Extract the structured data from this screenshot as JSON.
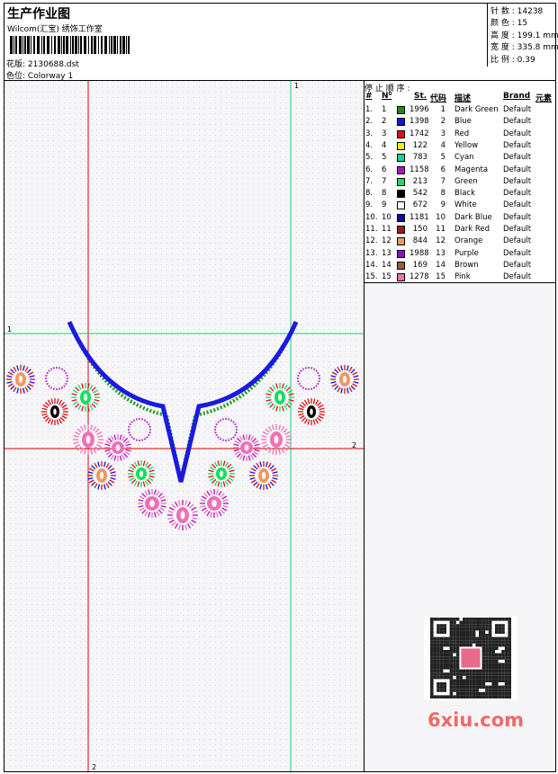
{
  "header": {
    "title": "生产作业图",
    "company": "Wilcom(汇宝) 绣饰工作室",
    "design_label": "花版:",
    "design_value": "2130688.dst",
    "colorway_label": "色位:",
    "colorway_value": "Colorway 1"
  },
  "stats": [
    {
      "label": "针 数 :",
      "value": "14238"
    },
    {
      "label": "颜 色 :",
      "value": "15"
    },
    {
      "label": "高 度 :",
      "value": "199.1 mm"
    },
    {
      "label": "宽 度 :",
      "value": "335.8 mm"
    },
    {
      "label": "比 例 :",
      "value": "0.39"
    }
  ],
  "guides": {
    "h1_label": "1",
    "h2_label": "2",
    "v1_label": "1",
    "v2_label": "2"
  },
  "legend": {
    "title": "停 止 顺 序 :",
    "headers": {
      "num": "#",
      "no": "N⁰",
      "st": "St.",
      "code": "代码",
      "desc": "描述",
      "brand": "Brand",
      "elem": "元素"
    },
    "rows": [
      {
        "num": "1.",
        "no": "1",
        "color": "#1a8a1a",
        "st": "1996",
        "code": "1",
        "desc": "Dark Green",
        "brand": "Default"
      },
      {
        "num": "2.",
        "no": "2",
        "color": "#1414d2",
        "st": "1398",
        "code": "2",
        "desc": "Blue",
        "brand": "Default"
      },
      {
        "num": "3.",
        "no": "3",
        "color": "#e01010",
        "st": "1742",
        "code": "3",
        "desc": "Red",
        "brand": "Default"
      },
      {
        "num": "4.",
        "no": "4",
        "color": "#f0f000",
        "st": "122",
        "code": "4",
        "desc": "Yellow",
        "brand": "Default"
      },
      {
        "num": "5.",
        "no": "5",
        "color": "#10d890",
        "st": "783",
        "code": "5",
        "desc": "Cyan",
        "brand": "Default"
      },
      {
        "num": "6.",
        "no": "6",
        "color": "#b010c8",
        "st": "1158",
        "code": "6",
        "desc": "Magenta",
        "brand": "Default"
      },
      {
        "num": "7.",
        "no": "7",
        "color": "#10e060",
        "st": "213",
        "code": "7",
        "desc": "Green",
        "brand": "Default"
      },
      {
        "num": "8.",
        "no": "8",
        "color": "#000000",
        "st": "542",
        "code": "8",
        "desc": "Black",
        "brand": "Default"
      },
      {
        "num": "9.",
        "no": "9",
        "color": "#ffffff",
        "st": "672",
        "code": "9",
        "desc": "White",
        "brand": "Default"
      },
      {
        "num": "10.",
        "no": "10",
        "color": "#0c0cb0",
        "st": "1181",
        "code": "10",
        "desc": "Dark Blue",
        "brand": "Default"
      },
      {
        "num": "11.",
        "no": "11",
        "color": "#a01818",
        "st": "150",
        "code": "11",
        "desc": "Dark Red",
        "brand": "Default"
      },
      {
        "num": "12.",
        "no": "12",
        "color": "#f09860",
        "st": "844",
        "code": "12",
        "desc": "Orange",
        "brand": "Default"
      },
      {
        "num": "13.",
        "no": "13",
        "color": "#8810c0",
        "st": "1988",
        "code": "13",
        "desc": "Purple",
        "brand": "Default"
      },
      {
        "num": "14.",
        "no": "14",
        "color": "#9a5a3a",
        "st": "169",
        "code": "14",
        "desc": "Brown",
        "brand": "Default"
      },
      {
        "num": "15.",
        "no": "15",
        "color": "#f070b8",
        "st": "1278",
        "code": "15",
        "desc": "Pink",
        "brand": "Default"
      }
    ]
  },
  "watermark": "6xiu.com",
  "colors": {
    "guide_red": "#e00000",
    "guide_green": "#20d070",
    "outline_blue": "#1a1ae0",
    "satin_green": "#20a020"
  }
}
